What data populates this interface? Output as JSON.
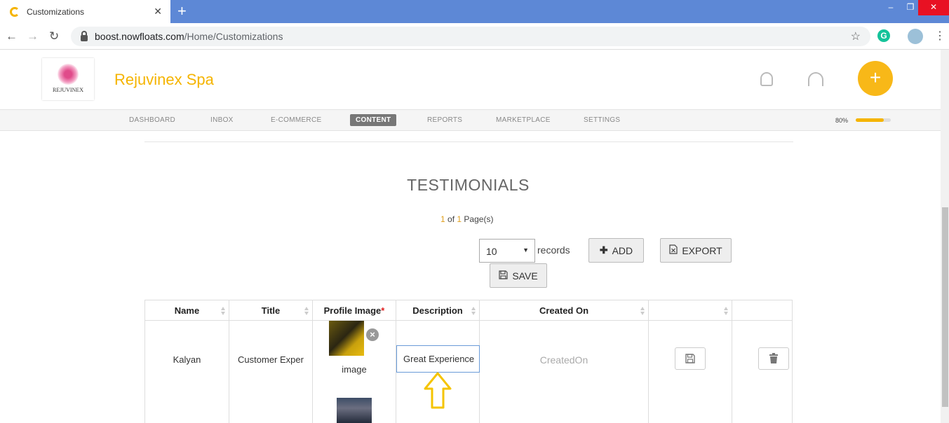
{
  "browser": {
    "tab_title": "Customizations",
    "tab_close": "✕",
    "new_tab": "+",
    "url_host": "boost.nowfloats.com",
    "url_path": "/Home/Customizations",
    "controls": {
      "minimize": "–",
      "maximize": "❐",
      "close": "✕"
    },
    "extension_letter": "G"
  },
  "header": {
    "logo_text": "REJUVINEX",
    "brand_name": "Rejuvinex Spa",
    "fab_label": "+"
  },
  "nav": {
    "items": [
      "DASHBOARD",
      "INBOX",
      "E-COMMERCE",
      "CONTENT",
      "REPORTS",
      "MARKETPLACE",
      "SETTINGS"
    ],
    "active": "CONTENT",
    "progress_label": "80%",
    "progress_fraction": 0.8
  },
  "main": {
    "section_title": "TESTIMONIALS",
    "pager": {
      "current": "1",
      "of_text": "of",
      "total": "1",
      "suffix": "Page(s)"
    },
    "records_value": "10",
    "records_label": "records",
    "add_label": "ADD",
    "export_label": "EXPORT",
    "save_label": "SAVE"
  },
  "table": {
    "headers": [
      "Name",
      "Title",
      "Profile Image",
      "Description",
      "Created On",
      "",
      ""
    ],
    "required_mark": "*",
    "row": {
      "name": "Kalyan",
      "title": "Customer Exper",
      "image_label": "image",
      "description": "Great Experience",
      "created_on_placeholder": "CreatedOn"
    }
  },
  "colors": {
    "accent": "#f5b400",
    "tabstrip": "#5d88d6",
    "input_focus": "#6a9bd8"
  },
  "icons": [
    "search-icon",
    "bell-icon",
    "headset-icon",
    "plus-icon",
    "export-icon",
    "save-icon",
    "trash-icon",
    "remove-icon",
    "arrow-up-icon"
  ]
}
